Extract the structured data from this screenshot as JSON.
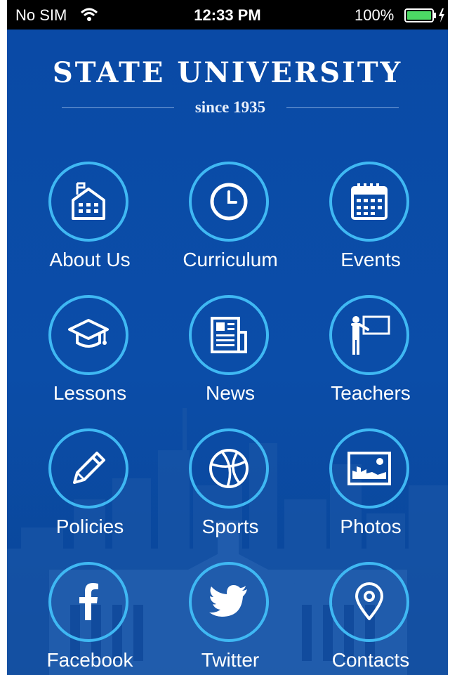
{
  "status_bar": {
    "carrier": "No SIM",
    "time": "12:33 PM",
    "battery": "100%"
  },
  "header": {
    "title": "STATE UNIVERSITY",
    "subtitle": "since 1935"
  },
  "menu": [
    {
      "label": "About Us",
      "icon": "school-building-icon"
    },
    {
      "label": "Curriculum",
      "icon": "clock-icon"
    },
    {
      "label": "Events",
      "icon": "calendar-icon"
    },
    {
      "label": "Lessons",
      "icon": "graduation-cap-icon"
    },
    {
      "label": "News",
      "icon": "newspaper-icon"
    },
    {
      "label": "Teachers",
      "icon": "teacher-board-icon"
    },
    {
      "label": "Policies",
      "icon": "pencil-icon"
    },
    {
      "label": "Sports",
      "icon": "basketball-icon"
    },
    {
      "label": "Photos",
      "icon": "photo-icon"
    },
    {
      "label": "Facebook",
      "icon": "facebook-icon"
    },
    {
      "label": "Twitter",
      "icon": "twitter-icon"
    },
    {
      "label": "Contacts",
      "icon": "location-pin-icon"
    }
  ],
  "colors": {
    "background": "#0b4da8",
    "ring": "#3fb8f3",
    "text": "#ffffff"
  }
}
